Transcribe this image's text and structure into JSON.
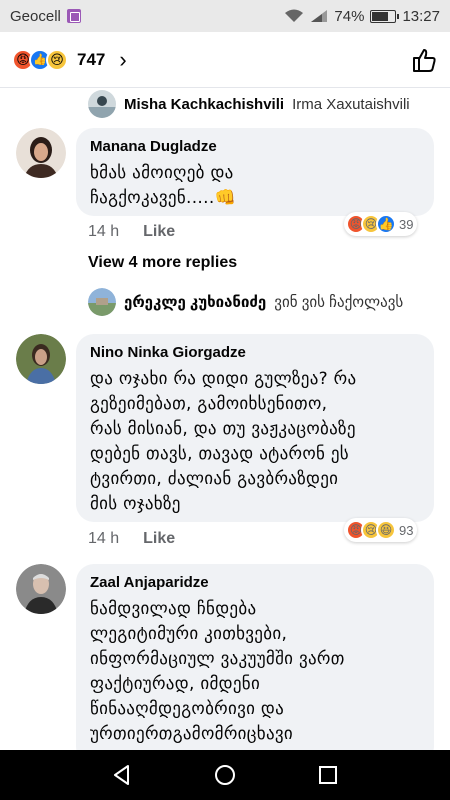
{
  "status_bar": {
    "carrier": "Geocell",
    "battery": "74%",
    "battery_level": 0.74,
    "time": "13:27"
  },
  "header": {
    "reaction_count": "747",
    "reactions": [
      "angry",
      "like",
      "sad"
    ]
  },
  "reply_previews": [
    {
      "name": "Misha Kachkachishvili",
      "text": "Irma Xaxutaishvili"
    },
    {
      "name": "ერეკლე კუხიანიძე",
      "text": "ვინ ვის ჩაქოლავს"
    }
  ],
  "comments": [
    {
      "name": "Manana Dugladze",
      "text_lines": [
        "ხმას ამოიღებ და",
        "ჩაგქოკავენ.....👊"
      ],
      "time": "14 h",
      "like_label": "Like",
      "reactions": [
        "angry",
        "sad",
        "like"
      ],
      "reaction_count": "39"
    },
    {
      "name": "Nino Ninka Giorgadze",
      "text_lines": [
        "და ოჯახი რა დიდი გულზეა? რა",
        "გეზეიმებათ, გამოიხსენითო,",
        "რას მისიან, და თუ ვაჟკაცობაზე",
        "დებენ თავს, თავად ატარონ ეს",
        "ტვირთი, ძალიან გავბრაზდეი",
        "მის ოჯახზე"
      ],
      "time": "14 h",
      "like_label": "Like",
      "reactions": [
        "angry",
        "sad",
        "haha"
      ],
      "reaction_count": "93"
    },
    {
      "name": "Zaal Anjaparidze",
      "text_lines": [
        "ნამდვილად ჩნდება",
        "ლეგიტიმური კითხვები,",
        "ინფორმაციულ ვაკუუმში ვართ",
        "ფაქტიურად, იმდენი",
        "წინააღმდეგობრივი და",
        "ურთიერთგამომრიცხავი"
      ]
    }
  ],
  "view_more": "View 4 more replies",
  "colors": {
    "bubble_bg": "#f0f2f5",
    "muted_text": "#65676b",
    "like_blue": "#1877f2",
    "angry_orange": "#f0542c",
    "sad_yellow": "#f7c53c"
  }
}
